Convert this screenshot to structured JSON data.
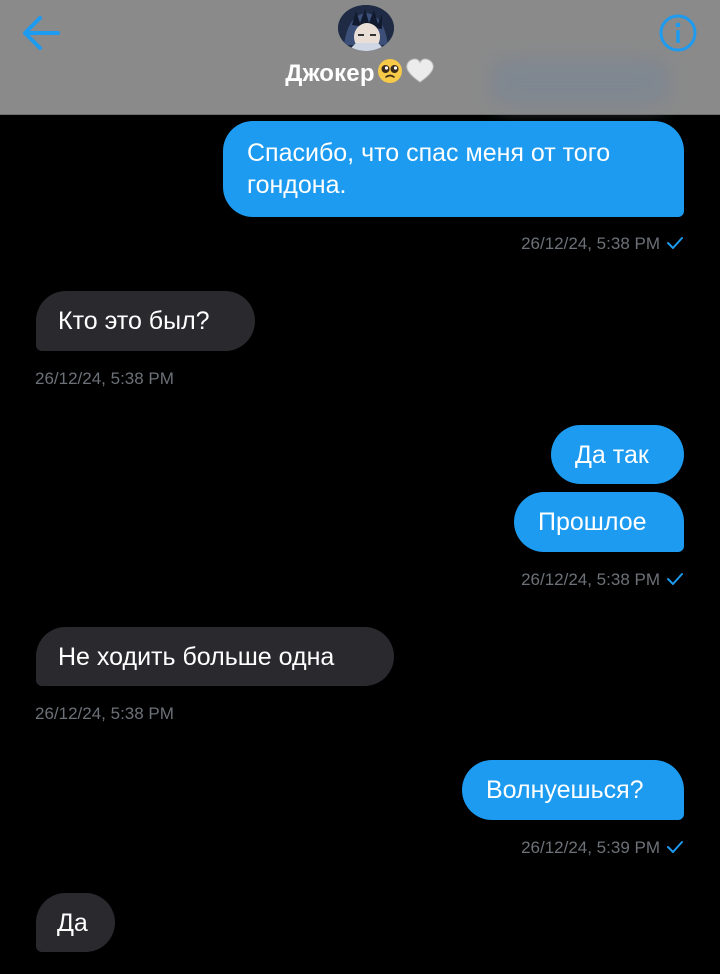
{
  "header": {
    "contact_name": "Джокер",
    "back_icon": "arrow-left-icon",
    "info_icon": "info-icon",
    "accent_color": "#1d9bf0"
  },
  "messages": [
    {
      "direction": "outgoing",
      "text_lines": [
        "Спасибо, что спас меня от того",
        "гондона."
      ]
    },
    {
      "direction": "outgoing_meta",
      "timestamp": "26/12/24, 5:38 PM",
      "status": "sent"
    },
    {
      "direction": "incoming",
      "text": "Кто это был?",
      "timestamp": "26/12/24, 5:38 PM"
    },
    {
      "direction": "outgoing",
      "text": "Да так"
    },
    {
      "direction": "outgoing",
      "text": "Прошлое",
      "timestamp": "26/12/24, 5:38 PM",
      "status": "sent"
    },
    {
      "direction": "incoming",
      "text": "Не ходить больше одна",
      "timestamp": "26/12/24, 5:38 PM"
    },
    {
      "direction": "outgoing",
      "text": "Волнуешься?",
      "timestamp": "26/12/24, 5:39 PM",
      "status": "sent"
    },
    {
      "direction": "incoming",
      "text": "Да"
    }
  ]
}
